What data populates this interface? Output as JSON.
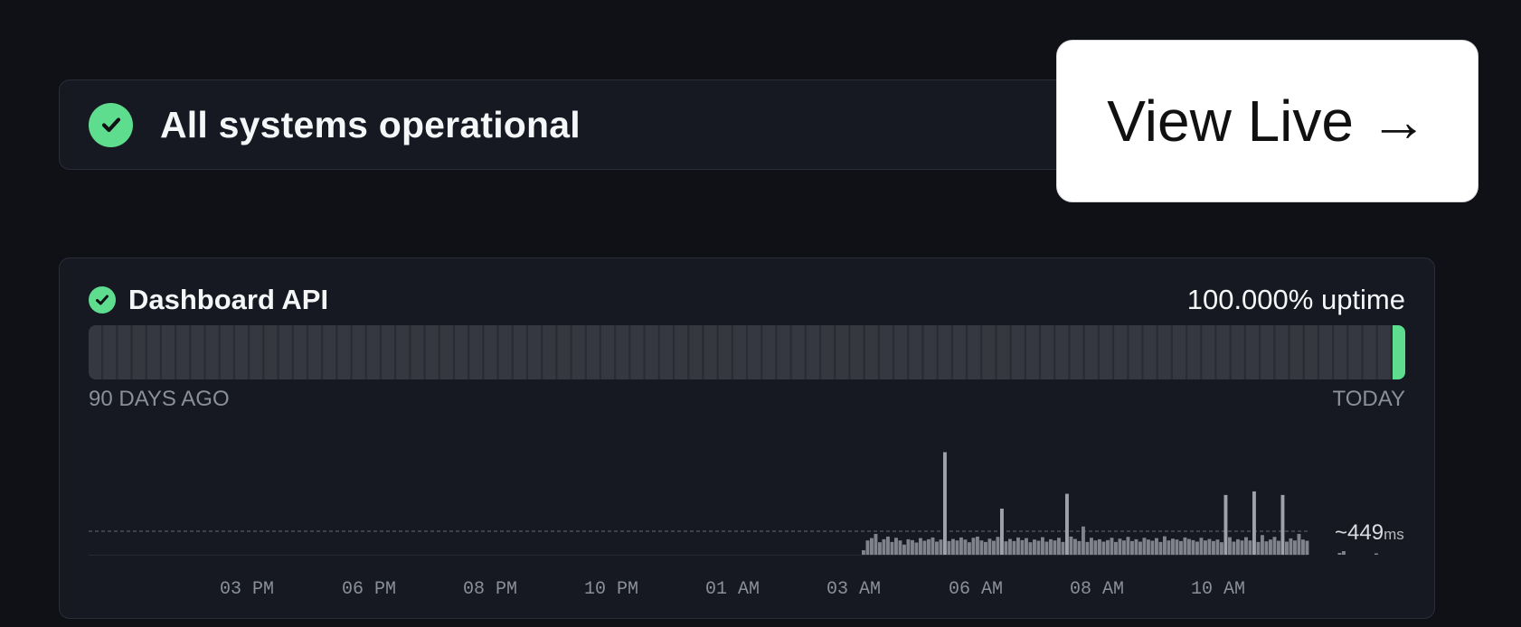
{
  "banner": {
    "status_text": "All systems operational",
    "status_color": "#5fdd8f",
    "icon": "check-circle-icon"
  },
  "view_live": {
    "label": "View Live →"
  },
  "component": {
    "name": "Dashboard API",
    "uptime": "100.000% uptime",
    "range_start": "90 DAYS AGO",
    "range_end": "TODAY",
    "today_color": "#5fdd8f",
    "days": 90,
    "days_with_data": 1
  },
  "chart_data": {
    "type": "bar",
    "average_label": "~449",
    "average_unit": "ms",
    "x_tick_labels": [
      "03 PM",
      "06 PM",
      "08 PM",
      "10 PM",
      "01 AM",
      "03 AM",
      "06 AM",
      "08 AM",
      "10 AM"
    ],
    "values_ms": [
      0,
      0,
      0,
      0,
      0,
      0,
      0,
      0,
      0,
      0,
      0,
      0,
      0,
      0,
      0,
      0,
      0,
      0,
      0,
      0,
      0,
      0,
      0,
      0,
      0,
      0,
      0,
      0,
      0,
      0,
      0,
      0,
      0,
      0,
      0,
      0,
      0,
      0,
      0,
      0,
      0,
      0,
      0,
      0,
      0,
      0,
      0,
      0,
      0,
      0,
      0,
      0,
      0,
      0,
      0,
      0,
      0,
      0,
      0,
      0,
      0,
      0,
      0,
      0,
      0,
      0,
      0,
      0,
      0,
      0,
      0,
      0,
      0,
      0,
      0,
      0,
      0,
      0,
      0,
      0,
      0,
      0,
      0,
      0,
      0,
      0,
      0,
      0,
      0,
      0,
      0,
      0,
      0,
      0,
      0,
      0,
      0,
      0,
      0,
      0,
      0,
      0,
      0,
      0,
      0,
      0,
      0,
      0,
      0,
      0,
      0,
      0,
      0,
      0,
      0,
      0,
      0,
      0,
      0,
      0,
      0,
      0,
      0,
      0,
      0,
      0,
      0,
      0,
      0,
      0,
      0,
      0,
      0,
      0,
      0,
      0,
      0,
      0,
      0,
      0,
      0,
      0,
      0,
      0,
      0,
      0,
      0,
      0,
      0,
      0,
      0,
      0,
      0,
      0,
      0,
      0,
      0,
      0,
      0,
      0,
      0,
      0,
      0,
      0,
      0,
      0,
      0,
      0,
      0,
      0,
      0,
      0,
      0,
      0,
      0,
      0,
      0,
      0,
      0,
      0,
      0,
      0,
      0,
      0,
      0,
      0,
      0,
      0,
      0,
      0,
      150,
      480,
      560,
      700,
      420,
      520,
      610,
      430,
      570,
      480,
      340,
      520,
      490,
      410,
      560,
      470,
      520,
      580,
      440,
      510,
      3450,
      460,
      530,
      480,
      580,
      510,
      420,
      570,
      610,
      480,
      430,
      540,
      470,
      600,
      1550,
      450,
      530,
      460,
      580,
      490,
      560,
      420,
      510,
      470,
      590,
      440,
      520,
      480,
      570,
      430,
      2050,
      610,
      530,
      460,
      950,
      430,
      570,
      480,
      520,
      440,
      490,
      570,
      430,
      540,
      480,
      600,
      460,
      520,
      440,
      570,
      510,
      470,
      560,
      430,
      620,
      480,
      540,
      510,
      460,
      580,
      530,
      490,
      440,
      570,
      480,
      530,
      460,
      510,
      420,
      2010,
      590,
      440,
      520,
      480,
      590,
      480,
      2130,
      430,
      660,
      450,
      510,
      600,
      470,
      2010,
      440,
      550,
      480,
      700,
      510,
      470,
      0,
      0,
      0,
      0,
      0,
      0,
      0,
      60,
      120,
      0,
      0,
      0,
      0,
      0,
      0,
      0,
      40,
      0,
      0,
      0,
      0,
      0,
      0,
      0,
      0,
      90,
      0,
      0,
      0,
      0,
      0,
      0,
      0,
      0,
      40,
      0,
      0,
      0,
      60,
      0,
      0,
      0,
      0,
      0,
      0,
      0,
      0,
      0
    ]
  }
}
